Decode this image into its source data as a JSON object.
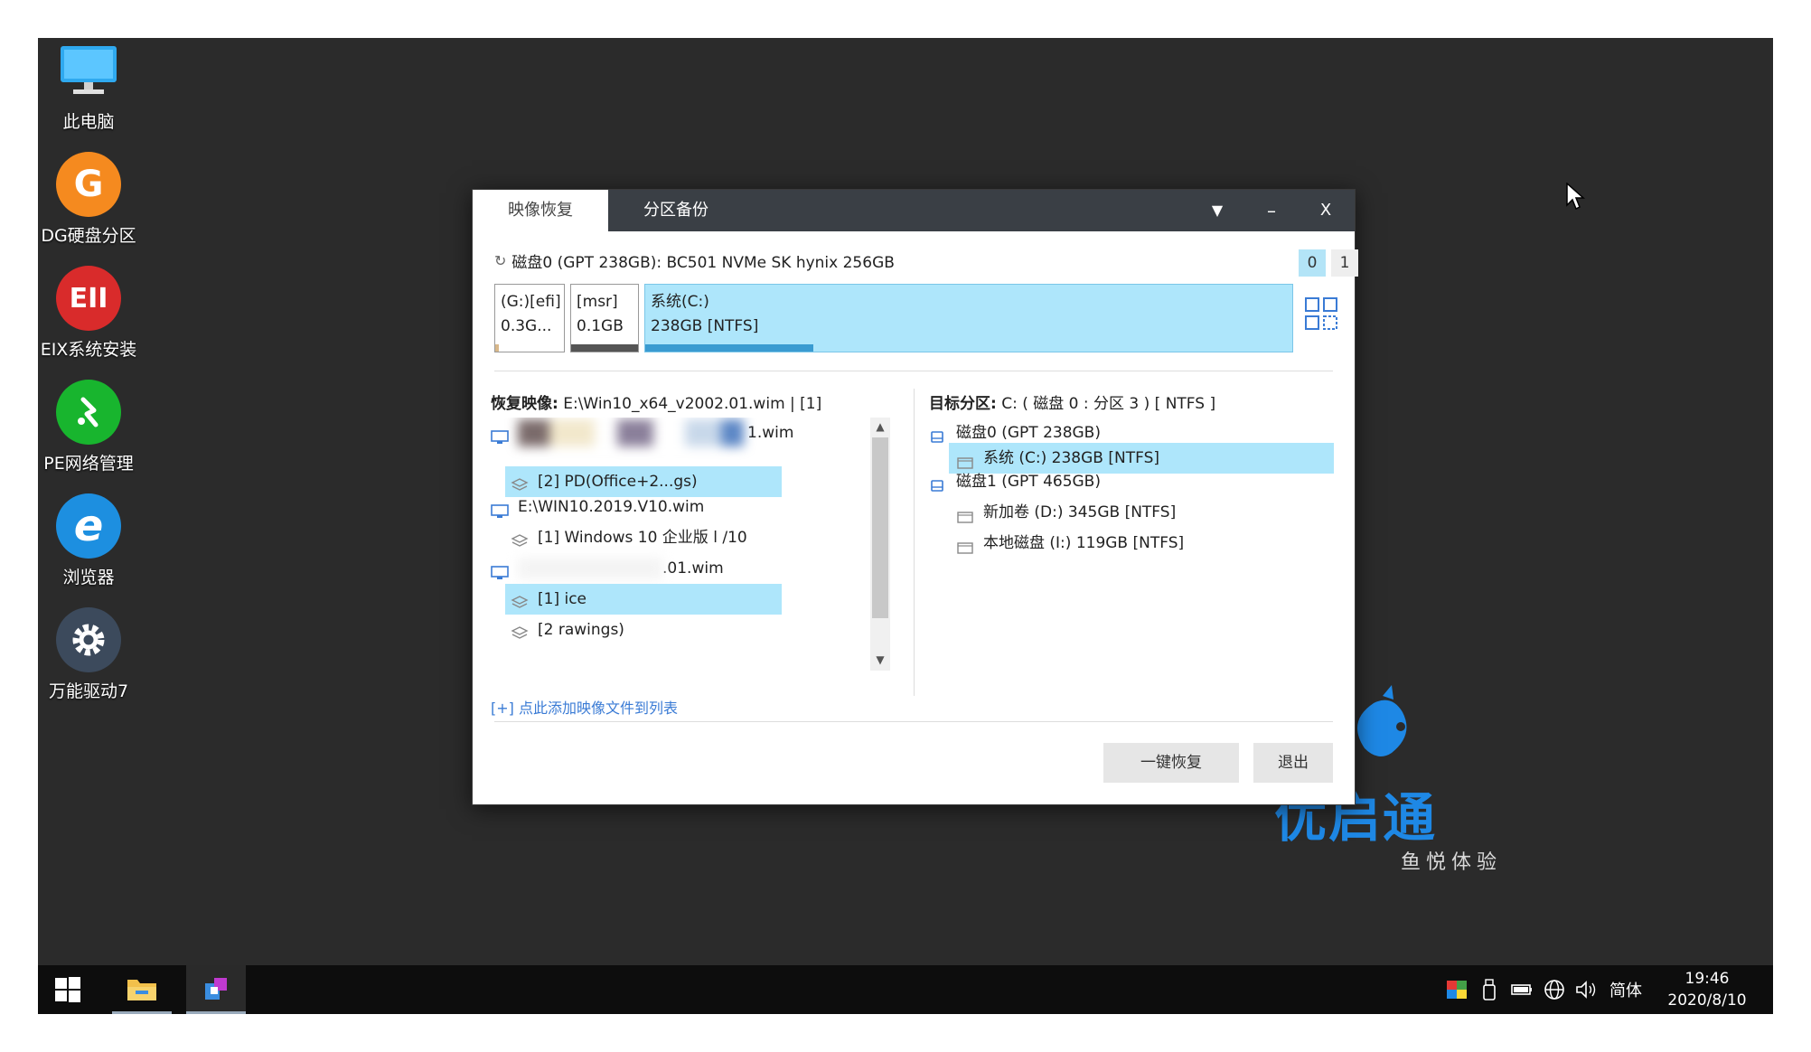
{
  "desktop": {
    "icons": [
      {
        "label": "此电脑"
      },
      {
        "label": "DG硬盘分区",
        "glyph": "G"
      },
      {
        "label": "EIX系统安装",
        "glyph": "EII"
      },
      {
        "label": "PE网络管理"
      },
      {
        "label": "浏览器",
        "glyph": "e"
      },
      {
        "label": "万能驱动7"
      }
    ],
    "watermark": {
      "text": "优启通",
      "sub": "鱼悦体验"
    }
  },
  "dialog": {
    "tabs": [
      {
        "label": "映像恢复"
      },
      {
        "label": "分区备份"
      }
    ],
    "window_buttons": {
      "menu": "▼",
      "minimize": "–",
      "close": "X"
    },
    "disk_line": "磁盘0 (GPT 238GB): BC501 NVMe SK hynix 256GB",
    "disk_selectors": [
      "0",
      "1"
    ],
    "partitions": [
      {
        "line1": "(G:)[efi]",
        "line2": "0.3G...",
        "used_percent": 5
      },
      {
        "line1": "[msr]",
        "line2": "0.1GB",
        "used_percent": 100
      },
      {
        "line1": "系统(C:)",
        "line2": "238GB [NTFS]",
        "used_percent": 26
      }
    ],
    "left_header": {
      "label": "恢复映像:",
      "value": "E:\\Win10_x64_v2002.01.wim | [1]"
    },
    "left_items": [
      {
        "text": "1.wim",
        "type": "file",
        "blurred": true
      },
      {
        "text": "[2] PD(Office+2...gs)",
        "type": "image",
        "selected": true
      },
      {
        "text": "E:\\WIN10.2019.V10.wim",
        "type": "file"
      },
      {
        "text": "[1] Windows 10 企业版 l    /10",
        "type": "image"
      },
      {
        "text": ".01.wim",
        "type": "file",
        "blurred": true
      },
      {
        "text": "[1]    ice",
        "type": "image",
        "selected": true,
        "blurred": true
      },
      {
        "text": "[2                         rawings)",
        "type": "image",
        "blurred": true
      }
    ],
    "add_link": "[+] 点此添加映像文件到列表",
    "right_header": {
      "label": "目标分区:",
      "value": "C: ( 磁盘 0 : 分区 3 ) [ NTFS ]"
    },
    "right_items": [
      {
        "text": "磁盘0 (GPT 238GB)",
        "level": 0
      },
      {
        "text": "系统 (C:) 238GB [NTFS]",
        "level": 1,
        "selected": true
      },
      {
        "text": "磁盘1 (GPT 465GB)",
        "level": 0
      },
      {
        "text": "新加卷 (D:) 345GB [NTFS]",
        "level": 1
      },
      {
        "text": "本地磁盘 (I:) 119GB [NTFS]",
        "level": 1
      }
    ],
    "buttons": {
      "restore": "一键恢复",
      "exit": "退出"
    }
  },
  "taskbar": {
    "tray_lang": "简体",
    "time": "19:46",
    "date": "2020/8/10"
  },
  "colors": {
    "desktop_bg": "#2b2b2b",
    "titlebar": "#3a3f45",
    "selection": "#aee6fb",
    "accent_blue": "#1e88e5"
  }
}
